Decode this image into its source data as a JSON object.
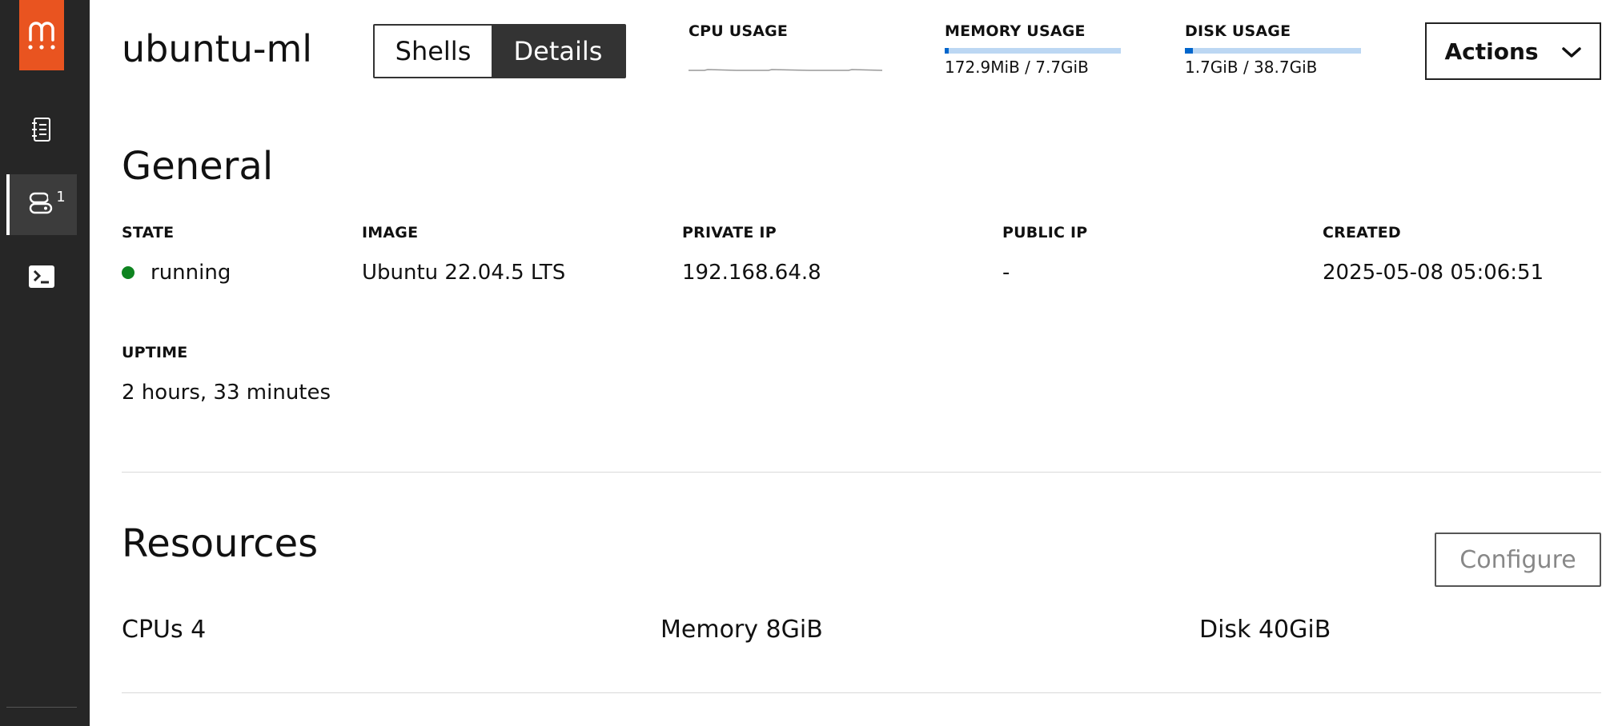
{
  "app": {
    "brand_color": "#e95420",
    "accent_color": "#0066cc"
  },
  "sidebar": {
    "logo_icon": "multipass-logo-icon",
    "items": [
      {
        "icon": "notebook-icon",
        "active": false
      },
      {
        "icon": "instances-icon",
        "active": true,
        "badge": "1"
      },
      {
        "icon": "terminal-icon",
        "active": false
      }
    ]
  },
  "header": {
    "instance_name": "ubuntu-ml",
    "tabs": [
      {
        "label": "Shells",
        "active": false
      },
      {
        "label": "Details",
        "active": true
      }
    ],
    "cpu": {
      "label": "CPU USAGE"
    },
    "memory": {
      "label": "MEMORY USAGE",
      "value": "172.9MiB / 7.7GiB",
      "fraction": 0.022
    },
    "disk": {
      "label": "DISK USAGE",
      "value": "1.7GiB / 38.7GiB",
      "fraction": 0.044
    },
    "actions_label": "Actions",
    "actions_icon": "chevron-down-icon"
  },
  "general": {
    "title": "General",
    "state": {
      "label": "STATE",
      "value": "running",
      "status_color": "#0e8420"
    },
    "image": {
      "label": "IMAGE",
      "value": "Ubuntu 22.04.5 LTS"
    },
    "private_ip": {
      "label": "PRIVATE IP",
      "value": "192.168.64.8"
    },
    "public_ip": {
      "label": "PUBLIC IP",
      "value": "-"
    },
    "created": {
      "label": "CREATED",
      "value": "2025-05-08 05:06:51"
    },
    "uptime": {
      "label": "UPTIME",
      "value": "2 hours, 33 minutes"
    }
  },
  "resources": {
    "title": "Resources",
    "configure_label": "Configure",
    "cpus": "CPUs 4",
    "memory": "Memory 8GiB",
    "disk": "Disk 40GiB"
  }
}
